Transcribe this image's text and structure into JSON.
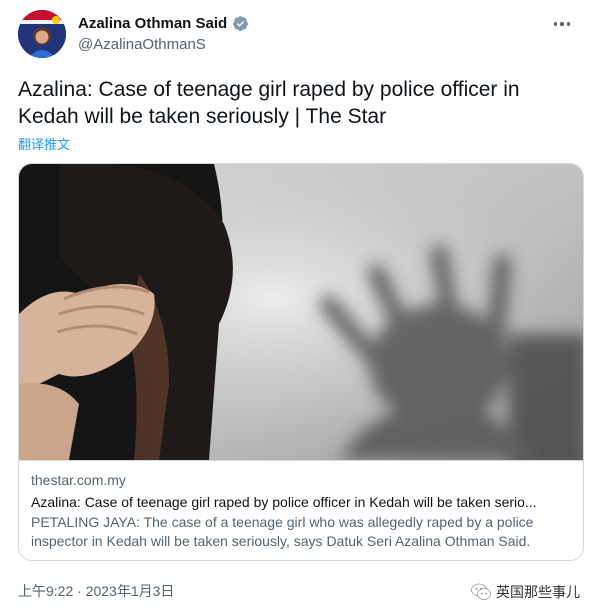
{
  "author": {
    "display_name": "Azalina Othman Said",
    "handle": "@AzalinaOthmanS",
    "verified": true
  },
  "tweet": {
    "text": "Azalina: Case of teenage girl raped by police officer in Kedah will be taken seriously | The Star",
    "translate_label": "翻译推文"
  },
  "card": {
    "domain": "thestar.com.my",
    "title": "Azalina: Case of teenage girl raped by police officer in Kedah will be taken serio...",
    "description": "PETALING JAYA: The case of a teenage girl who was allegedly raped by a police inspector in Kedah will be taken seriously, says Datuk Seri Azalina Othman Said."
  },
  "footer": {
    "timestamp": "上午9:22 · 2023年1月3日"
  },
  "watermark": {
    "text": "英国那些事儿"
  },
  "colors": {
    "accent": "#1d9bf0",
    "text_primary": "#0f1419",
    "text_secondary": "#536471",
    "border": "#cfd9de"
  }
}
